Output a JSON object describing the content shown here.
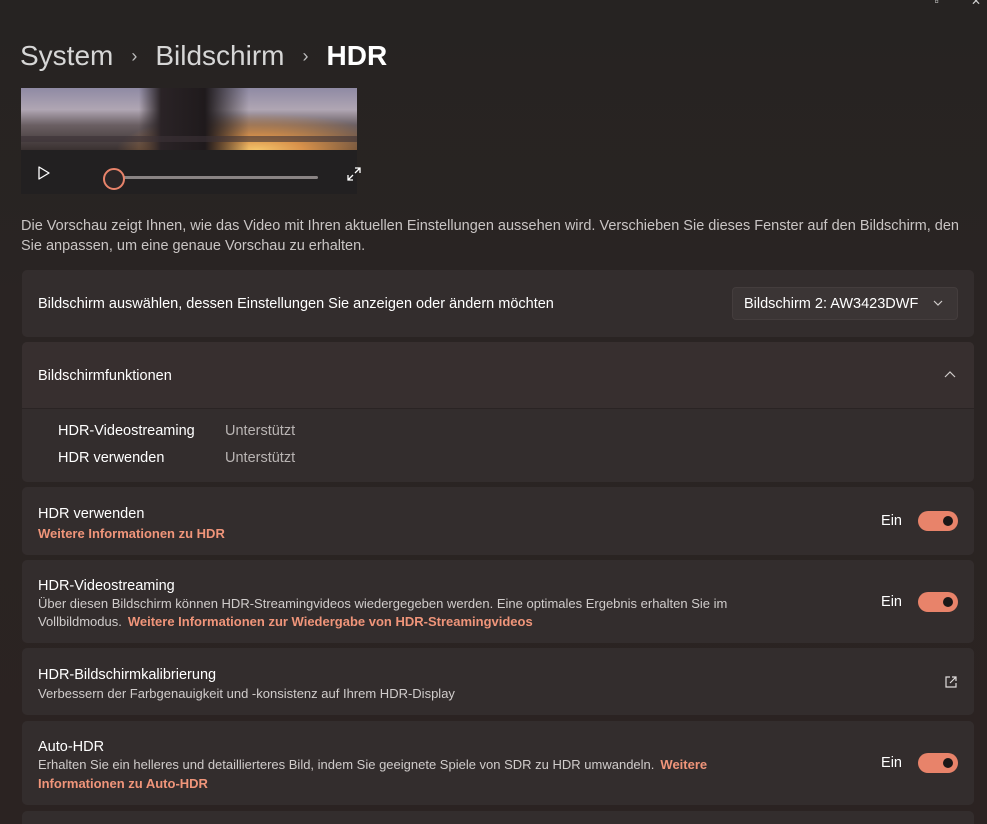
{
  "breadcrumb": {
    "items": [
      "System",
      "Bildschirm",
      "HDR"
    ]
  },
  "preview": {
    "note": "Die Vorschau zeigt Ihnen, wie das Video mit Ihren aktuellen Einstellungen aussehen wird. Verschieben Sie dieses Fenster auf den Bildschirm, den Sie anpassen, um eine genaue Vorschau zu erhalten.",
    "seek_position": 0
  },
  "display_select": {
    "label": "Bildschirm auswählen, dessen Einstellungen Sie anzeigen oder ändern möchten",
    "selected": "Bildschirm 2: AW3423DWF"
  },
  "capabilities": {
    "title": "Bildschirmfunktionen",
    "expanded": true,
    "rows": [
      {
        "name": "HDR-Videostreaming",
        "value": "Unterstützt"
      },
      {
        "name": "HDR verwenden",
        "value": "Unterstützt"
      }
    ]
  },
  "settings": {
    "use_hdr": {
      "title": "HDR verwenden",
      "link": "Weitere Informationen zu HDR",
      "state": "Ein"
    },
    "hdr_video": {
      "title": "HDR-Videostreaming",
      "desc_line1": "Über diesen Bildschirm können HDR-Streamingvideos wiedergegeben werden. Eine optimales Ergebnis erhalten Sie im",
      "desc_line2": "Vollbildmodus.",
      "link": "Weitere Informationen zur Wiedergabe von HDR-Streamingvideos",
      "state": "Ein"
    },
    "calibration": {
      "title": "HDR-Bildschirmkalibrierung",
      "desc": "Verbessern der Farbgenauigkeit und -konsistenz auf Ihrem HDR-Display"
    },
    "auto_hdr": {
      "title": "Auto-HDR",
      "desc": "Erhalten Sie ein helleres und detaillierteres Bild, indem Sie geeignete Spiele von SDR zu HDR umwandeln.",
      "link_part1": "Weitere",
      "link_part2": "Informationen zu Auto-HDR",
      "state": "Ein"
    }
  },
  "colors": {
    "accent": "#e8836a",
    "link": "#f0957a",
    "card": "#332d2d"
  }
}
